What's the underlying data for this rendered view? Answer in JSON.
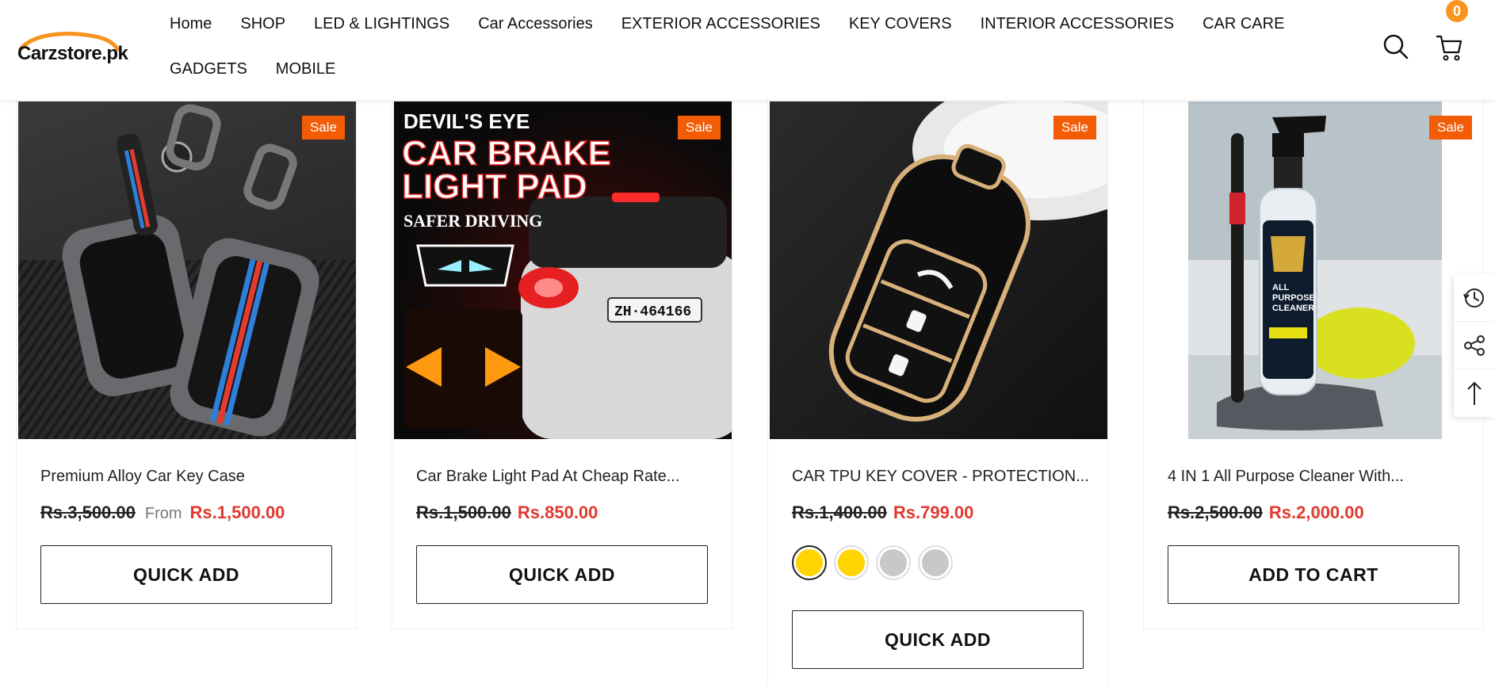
{
  "header": {
    "logo_text": "Carzstore.pk",
    "nav_row1": [
      "Home",
      "SHOP",
      "LED & LIGHTINGS",
      "Car Accessories",
      "EXTERIOR ACCESSORIES",
      "KEY COVERS",
      "INTERIOR ACCESSORIES",
      "CAR CARE"
    ],
    "nav_row2": [
      "GADGETS",
      "MOBILE"
    ],
    "cart_count": "0",
    "icons": {
      "search": "search-icon",
      "cart": "cart-icon"
    },
    "accent": "#f7931e"
  },
  "products": [
    {
      "badge": "Sale",
      "title": "Premium Alloy Car Key Case",
      "old_price": "Rs.3,500.00",
      "from_label": "From",
      "price": "Rs.1,500.00",
      "button": "QUICK ADD"
    },
    {
      "badge": "Sale",
      "title": "Car Brake Light Pad At Cheap Rate...",
      "old_price": "Rs.1,500.00",
      "price": "Rs.850.00",
      "button": "QUICK ADD",
      "image_text": {
        "line1": "DEVIL'S EYE",
        "line2": "CAR BRAKE",
        "line3": "LIGHT PAD",
        "line4": "SAFER DRIVING",
        "plate": "ZH·464166"
      }
    },
    {
      "badge": "Sale",
      "title": "CAR TPU KEY COVER - PROTECTION...",
      "old_price": "Rs.1,400.00",
      "price": "Rs.799.00",
      "button": "QUICK ADD",
      "swatches": [
        "#ffd400",
        "#ffd400",
        "#c8c8c8",
        "#c8c8c8"
      ]
    },
    {
      "badge": "Sale",
      "title": "4 IN 1 All Purpose Cleaner With...",
      "old_price": "Rs.2,500.00",
      "price": "Rs.2,000.00",
      "button": "ADD TO CART",
      "image_text": {
        "label1": "ALL",
        "label2": "PURPOSE",
        "label3": "CLEANER"
      }
    }
  ],
  "side_tools": [
    "history-icon",
    "share-icon",
    "arrow-up-icon"
  ],
  "colors": {
    "sale": "#f25c05",
    "price": "#e0392e"
  }
}
